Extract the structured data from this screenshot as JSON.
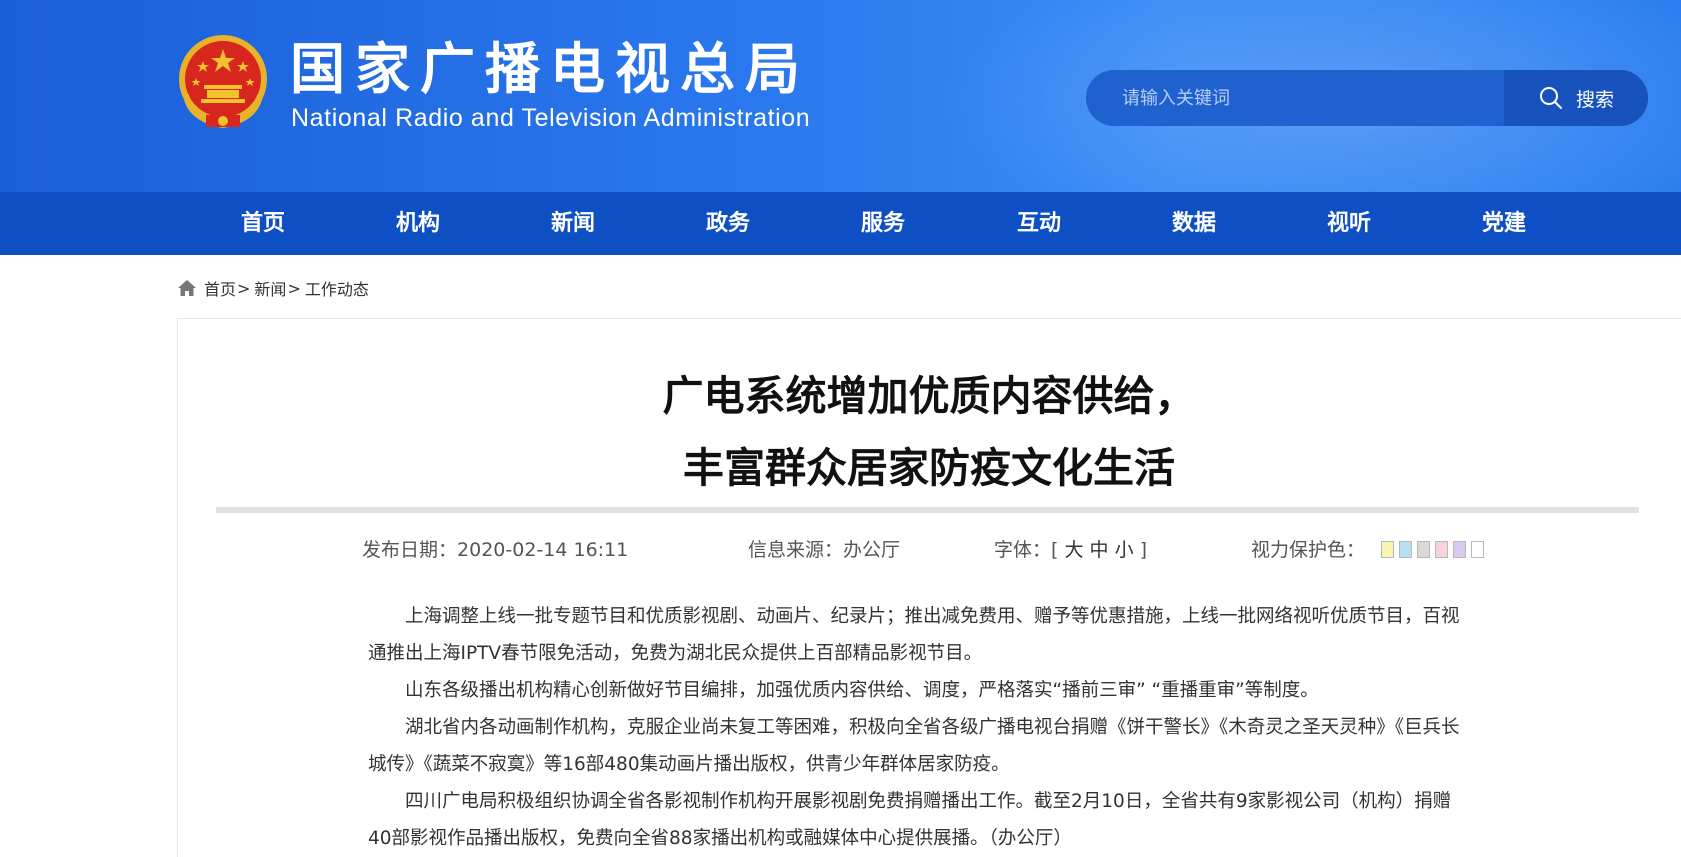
{
  "header": {
    "title_cn": "国家广播电视总局",
    "title_en": "National Radio and Television Administration",
    "search": {
      "placeholder": "请输入关键词",
      "button_label": "搜索"
    },
    "colors": {
      "primary": "#1a5fd8",
      "nav": "#0f4fc4",
      "emblem_red": "#d7261e",
      "emblem_gold": "#f2c12e"
    }
  },
  "nav": {
    "items": [
      {
        "label": "首页"
      },
      {
        "label": "机构"
      },
      {
        "label": "新闻"
      },
      {
        "label": "政务"
      },
      {
        "label": "服务"
      },
      {
        "label": "互动"
      },
      {
        "label": "数据"
      },
      {
        "label": "视听"
      },
      {
        "label": "党建"
      }
    ]
  },
  "breadcrumb": {
    "icon": "home-icon",
    "items": [
      "首页",
      "新闻",
      "工作动态"
    ],
    "separator": ">"
  },
  "article": {
    "title_line1": "广电系统增加优质内容供给，",
    "title_line2": "丰富群众居家防疫文化生活",
    "meta": {
      "date_label": "发布日期：",
      "date": "2020-02-14 16:11",
      "source_label": "信息来源：",
      "source": "办公厅",
      "font_label": "字体：",
      "font_open": "[",
      "font_large": "大",
      "font_medium": "中",
      "font_small": "小",
      "font_close": "]",
      "eye_label": "视力保护色："
    },
    "eye_colors": [
      "#fbf3b1",
      "#b6e0f2",
      "#d9d9d9",
      "#f7d3dc",
      "#dcc9f0",
      "#ffffff"
    ],
    "paragraphs": [
      "上海调整上线一批专题节目和优质影视剧、动画片、纪录片；推出减免费用、赠予等优惠措施，上线一批网络视听优质节目，百视通推出上海IPTV春节限免活动，免费为湖北民众提供上百部精品影视节目。",
      "山东各级播出机构精心创新做好节目编排，加强优质内容供给、调度，严格落实“播前三审” “重播重审”等制度。",
      "湖北省内各动画制作机构，克服企业尚未复工等困难，积极向全省各级广播电视台捐赠《饼干警长》《木奇灵之圣天灵种》《巨兵长城传》《蔬菜不寂寞》等16部480集动画片播出版权，供青少年群体居家防疫。",
      "四川广电局积极组织协调全省各影视制作机构开展影视剧免费捐赠播出工作。截至2月10日，全省共有9家影视公司（机构）捐赠40部影视作品播出版权，免费向全省88家播出机构或融媒体中心提供展播。（办公厅）"
    ]
  }
}
